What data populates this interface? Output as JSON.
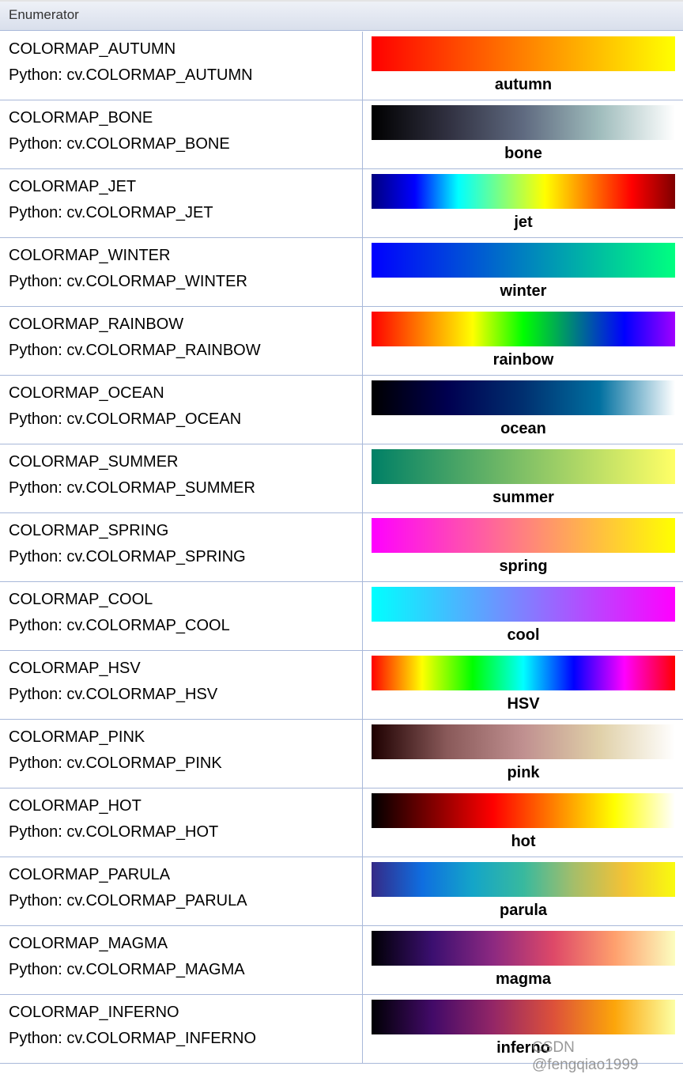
{
  "header": {
    "title": "Enumerator"
  },
  "rows": [
    {
      "name": "COLORMAP_AUTUMN",
      "python": "Python: cv.COLORMAP_AUTUMN",
      "label": "autumn",
      "stops": [
        "#ff0000",
        "#ff8000",
        "#ffff00"
      ]
    },
    {
      "name": "COLORMAP_BONE",
      "python": "Python: cv.COLORMAP_BONE",
      "label": "bone",
      "stops": [
        "#000000",
        "#303040",
        "#5f6a80",
        "#9fbcbc",
        "#ffffff"
      ]
    },
    {
      "name": "COLORMAP_JET",
      "python": "Python: cv.COLORMAP_JET",
      "label": "jet",
      "stops": [
        "#00007f",
        "#0000ff",
        "#00ffff",
        "#7fff7f",
        "#ffff00",
        "#ff7f00",
        "#ff0000",
        "#7f0000"
      ]
    },
    {
      "name": "COLORMAP_WINTER",
      "python": "Python: cv.COLORMAP_WINTER",
      "label": "winter",
      "stops": [
        "#0000ff",
        "#0080c0",
        "#00ff80"
      ]
    },
    {
      "name": "COLORMAP_RAINBOW",
      "python": "Python: cv.COLORMAP_RAINBOW",
      "label": "rainbow",
      "stops": [
        "#ff0000",
        "#ff8000",
        "#ffff00",
        "#00ff00",
        "#007f7f",
        "#0000ff",
        "#a000ff"
      ]
    },
    {
      "name": "COLORMAP_OCEAN",
      "python": "Python: cv.COLORMAP_OCEAN",
      "label": "ocean",
      "stops": [
        "#000000",
        "#000050",
        "#003070",
        "#0070a0",
        "#ffffff"
      ]
    },
    {
      "name": "COLORMAP_SUMMER",
      "python": "Python: cv.COLORMAP_SUMMER",
      "label": "summer",
      "stops": [
        "#008066",
        "#80c066",
        "#ffff66"
      ]
    },
    {
      "name": "COLORMAP_SPRING",
      "python": "Python: cv.COLORMAP_SPRING",
      "label": "spring",
      "stops": [
        "#ff00ff",
        "#ff8080",
        "#ffff00"
      ]
    },
    {
      "name": "COLORMAP_COOL",
      "python": "Python: cv.COLORMAP_COOL",
      "label": "cool",
      "stops": [
        "#00ffff",
        "#8080ff",
        "#ff00ff"
      ]
    },
    {
      "name": "COLORMAP_HSV",
      "python": "Python: cv.COLORMAP_HSV",
      "label": "HSV",
      "stops": [
        "#ff0000",
        "#ffff00",
        "#00ff00",
        "#00ffff",
        "#0000ff",
        "#ff00ff",
        "#ff0000"
      ]
    },
    {
      "name": "COLORMAP_PINK",
      "python": "Python: cv.COLORMAP_PINK",
      "label": "pink",
      "stops": [
        "#1e0000",
        "#8a5a5a",
        "#c09090",
        "#e0d0a8",
        "#ffffff"
      ]
    },
    {
      "name": "COLORMAP_HOT",
      "python": "Python: cv.COLORMAP_HOT",
      "label": "hot",
      "stops": [
        "#000000",
        "#800000",
        "#ff0000",
        "#ff8000",
        "#ffff00",
        "#ffffff"
      ]
    },
    {
      "name": "COLORMAP_PARULA",
      "python": "Python: cv.COLORMAP_PARULA",
      "label": "parula",
      "stops": [
        "#352a87",
        "#0f6ee0",
        "#14a5c8",
        "#38b99e",
        "#a5be6a",
        "#f4c235",
        "#f9fb0e"
      ]
    },
    {
      "name": "COLORMAP_MAGMA",
      "python": "Python: cv.COLORMAP_MAGMA",
      "label": "magma",
      "stops": [
        "#000004",
        "#3b0f70",
        "#8c2981",
        "#de4968",
        "#fe9f6d",
        "#fcfdbf"
      ]
    },
    {
      "name": "COLORMAP_INFERNO",
      "python": "Python: cv.COLORMAP_INFERNO",
      "label": "inferno",
      "stops": [
        "#000004",
        "#420a68",
        "#932667",
        "#dd513a",
        "#fca50a",
        "#fcffa4"
      ]
    }
  ],
  "watermark": "CSDN @fengqiao1999"
}
